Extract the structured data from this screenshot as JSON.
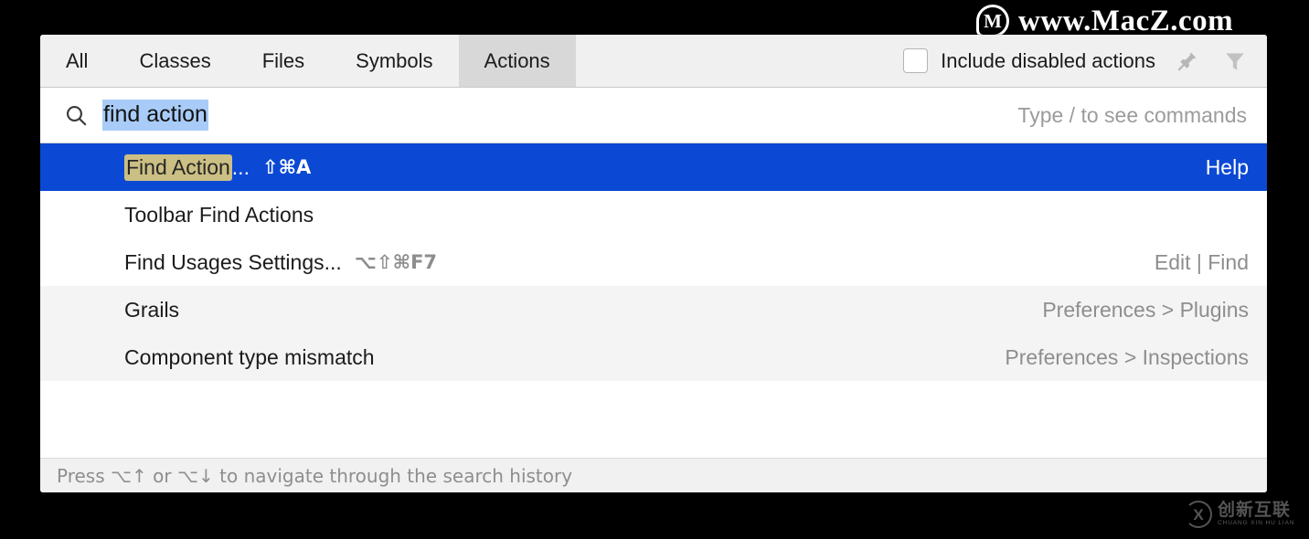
{
  "watermarks": {
    "top": {
      "logo_letter": "M",
      "text": "www.MacZ.com",
      "icon": "macz-logo-icon"
    },
    "bottom": {
      "logo_letter": "X",
      "cn": "创新互联",
      "pinyin": "CHUANG XIN HU LIAN",
      "icon": "chuangxin-logo-icon"
    }
  },
  "dialog": {
    "tabs": [
      {
        "label": "All",
        "active": false
      },
      {
        "label": "Classes",
        "active": false
      },
      {
        "label": "Files",
        "active": false
      },
      {
        "label": "Symbols",
        "active": false
      },
      {
        "label": "Actions",
        "active": true
      }
    ],
    "include_disabled": {
      "label": "Include disabled actions",
      "checked": false
    },
    "toolbar_icons": [
      {
        "name": "pin-icon",
        "glyph": "📌"
      },
      {
        "name": "filter-icon",
        "glyph": "▼"
      }
    ],
    "search": {
      "icon": "search-icon",
      "value": "find action",
      "placeholder": "Type / to see commands",
      "hint": "Type / to see commands",
      "selected": true
    },
    "results": [
      {
        "match": "Find Action",
        "rest": "...",
        "shortcut": "⇧⌘A",
        "meta": "Help",
        "selected": true,
        "shaded": false
      },
      {
        "match": "",
        "rest": "Toolbar Find Actions",
        "shortcut": "",
        "meta": "",
        "selected": false,
        "shaded": false
      },
      {
        "match": "",
        "rest": "Find Usages Settings...",
        "shortcut": "⌥⇧⌘F7",
        "meta": "Edit | Find",
        "selected": false,
        "shaded": false
      },
      {
        "match": "",
        "rest": "Grails",
        "shortcut": "",
        "meta": "Preferences > Plugins",
        "selected": false,
        "shaded": true
      },
      {
        "match": "",
        "rest": "Component type mismatch",
        "shortcut": "",
        "meta": "Preferences > Inspections",
        "selected": false,
        "shaded": true
      }
    ],
    "footer_hint": "Press ⌥↑ or ⌥↓ to navigate through the search history"
  },
  "colors": {
    "selection_blue": "#0b49d4",
    "search_selection": "#a8ccf7",
    "match_highlight": "#cbbf84",
    "tab_active": "#d8d8d8",
    "tabbar": "#f0f0f0",
    "row_shaded": "#f4f4f4"
  }
}
